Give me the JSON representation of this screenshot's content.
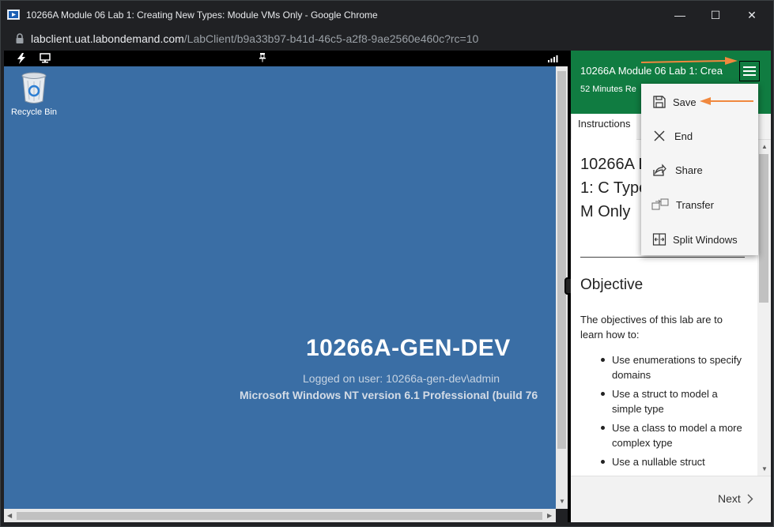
{
  "window": {
    "title": "10266A Module 06 Lab 1: Creating New Types: Module VMs Only - Google Chrome",
    "url_host": "labclient.uat.labondemand.com",
    "url_path": "/LabClient/b9a33b97-b41d-46c5-a2f8-9ae2560e460c?rc=10",
    "minimize_glyph": "—",
    "maximize_glyph": "☐",
    "close_glyph": "✕"
  },
  "vm": {
    "recycle_bin_label": "Recycle Bin",
    "machine_name": "10266A-GEN-DEV",
    "logged_on_user": "Logged on user: 10266a-gen-dev\\admin",
    "os_version": "Microsoft Windows NT version 6.1 Professional  (build 76",
    "desktop_color": "#3a6ea5"
  },
  "panel": {
    "lab_title": "10266A Module 06 Lab 1: Crea",
    "time_left": "52 Minutes Re",
    "header_color": "#107c41",
    "tab_instructions": "Instructions",
    "doc_title": "10266A Lab 1: C Types: M Only",
    "objective_heading": "Objective",
    "objective_intro": "The objectives of this lab are to learn how to:",
    "objectives": [
      "Use enumerations to specify domains",
      "Use a struct to model a simple type",
      "Use a class to model a more complex type",
      "Use a nullable struct"
    ],
    "next_label": "Next"
  },
  "menu": {
    "items": [
      {
        "label": "Save",
        "icon": "save-icon"
      },
      {
        "label": "End",
        "icon": "close-icon"
      },
      {
        "label": "Share",
        "icon": "share-icon"
      },
      {
        "label": "Transfer",
        "icon": "transfer-icon"
      },
      {
        "label": "Split Windows",
        "icon": "split-windows-icon"
      }
    ]
  },
  "annotation_color": "#f0883e"
}
